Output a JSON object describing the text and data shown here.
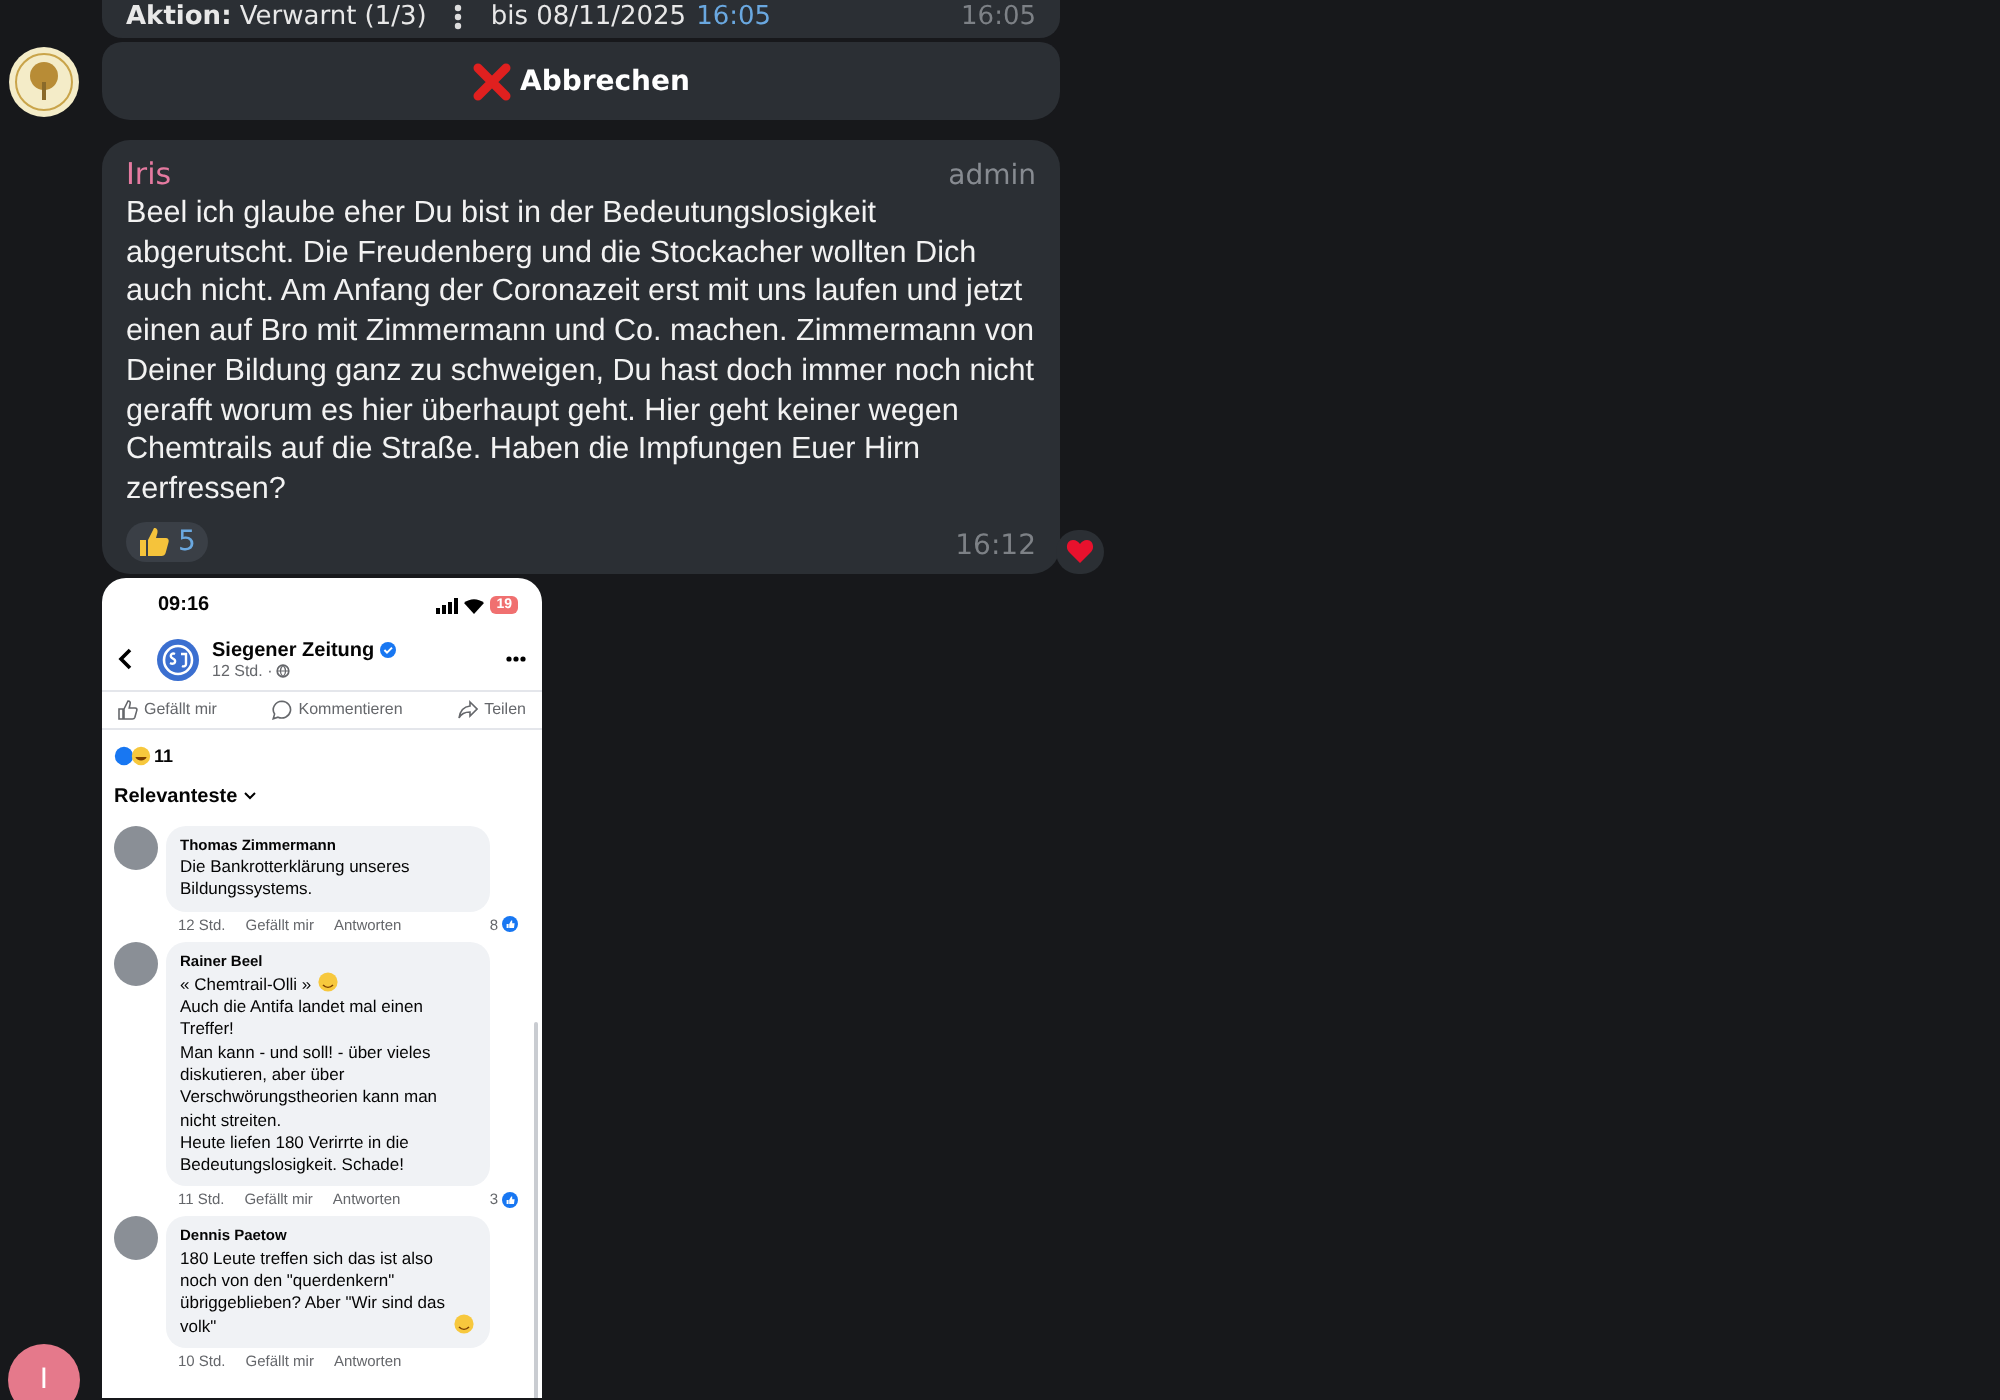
{
  "service": {
    "action_label": "Aktion:",
    "action_value": "Verwarnt (1/3)",
    "until": "bis 08/11/2025",
    "until_time": "16:05",
    "time": "16:05"
  },
  "inline_button": {
    "label": "Abbrechen"
  },
  "message": {
    "author": "Iris",
    "role": "admin",
    "text": "Beel ich glaube eher Du bist in der Bedeutungslosigkeit abgerutscht. Die Freudenberg und die Stockacher wollten Dich auch nicht. Am Anfang der Coronazeit erst mit uns laufen und jetzt einen auf Bro mit Zimmermann und Co. machen. Zimmermann von Deiner Bildung ganz zu schweigen, Du hast doch immer noch nicht gerafft worum es hier überhaupt geht. Hier geht keiner wegen Chemtrails auf die Straße. Haben die Impfungen Euer Hirn zerfressen?",
    "reactions": [
      {
        "kind": "thumbs-up",
        "count": "5",
        "selected": false
      }
    ],
    "time": "16:12",
    "heart_reaction": true
  },
  "screenshot": {
    "status_time": "09:16",
    "battery": "19",
    "page_name": "Siegener Zeitung",
    "verified": true,
    "post_meta": "12 Std. ·",
    "actions": [
      "Gefällt mir",
      "Kommentieren",
      "Teilen"
    ],
    "reaction_count": "11",
    "sort_label": "Relevanteste",
    "comments": [
      {
        "name": "Thomas Zimmermann",
        "paragraphs": [
          {
            "text": "Die Bankrotterklärung unseres Bildungssystems.",
            "emoji": false
          }
        ],
        "time": "12 Std.",
        "like": "Gefällt mir",
        "reply": "Antworten",
        "likes": "8"
      },
      {
        "name": "Rainer Beel",
        "paragraphs": [
          {
            "text": "« Chemtrail-Olli »",
            "emoji": true
          },
          {
            "text": "Auch die Antifa landet mal einen Treffer!",
            "emoji": false
          },
          {
            "text": "Man kann - und soll! - über vieles diskutieren, aber über Verschwörungstheorien kann man nicht streiten.",
            "emoji": false
          },
          {
            "text": "Heute liefen 180 Verirrte in die Bedeutungslosigkeit. Schade!",
            "emoji": false
          }
        ],
        "time": "11 Std.",
        "like": "Gefällt mir",
        "reply": "Antworten",
        "likes": "3"
      },
      {
        "name": "Dennis Paetow",
        "paragraphs": [
          {
            "text": "180 Leute treffen sich das ist also noch von den \"querdenkern\" übriggeblieben?  Aber \"Wir sind das volk\"",
            "emoji": true
          }
        ],
        "time": "10 Std.",
        "like": "Gefällt mir",
        "reply": "Antworten"
      }
    ]
  },
  "sender_avatar": {
    "initial": "I",
    "color": "#e5798b"
  }
}
